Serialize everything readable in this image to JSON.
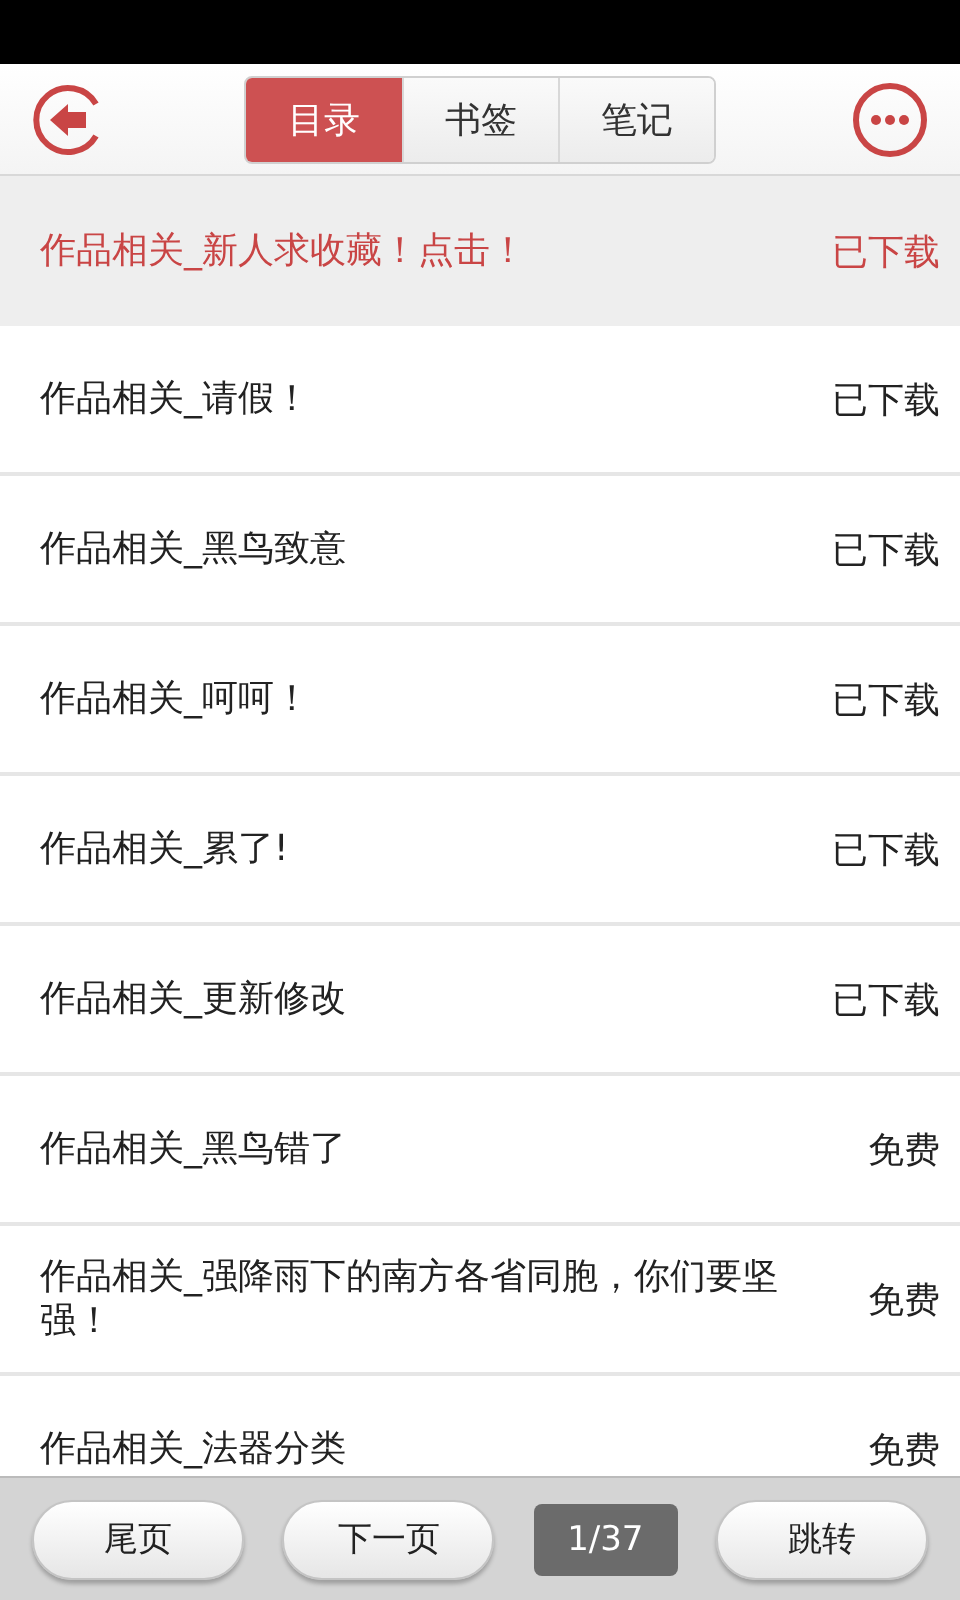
{
  "tabs": [
    {
      "label": "目录",
      "selected": true
    },
    {
      "label": "书签",
      "selected": false
    },
    {
      "label": "笔记",
      "selected": false
    }
  ],
  "chapters": [
    {
      "title": "作品相关_新人求收藏！点击！",
      "status": "已下载",
      "selected": true
    },
    {
      "title": "作品相关_请假！",
      "status": "已下载",
      "selected": false
    },
    {
      "title": "作品相关_黑鸟致意",
      "status": "已下载",
      "selected": false
    },
    {
      "title": "作品相关_呵呵！",
      "status": "已下载",
      "selected": false
    },
    {
      "title": "作品相关_累了!",
      "status": "已下载",
      "selected": false
    },
    {
      "title": "作品相关_更新修改",
      "status": "已下载",
      "selected": false
    },
    {
      "title": "作品相关_黑鸟错了",
      "status": "免费",
      "selected": false
    },
    {
      "title": "作品相关_强降雨下的南方各省同胞，你们要坚强！",
      "status": "免费",
      "selected": false
    },
    {
      "title": "作品相关_法器分类",
      "status": "免费",
      "selected": false
    }
  ],
  "pager": {
    "last_button": "尾页",
    "next_button": "下一页",
    "page": "1/37",
    "jump_button": "跳转"
  }
}
